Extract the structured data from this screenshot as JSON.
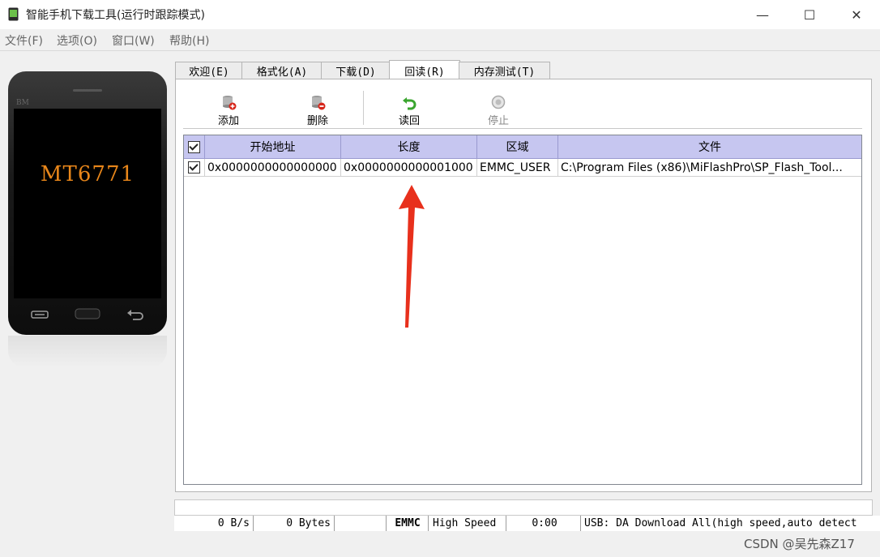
{
  "window": {
    "title": "智能手机下载工具(运行时跟踪模式)",
    "minimize_glyph": "—",
    "maximize_glyph": "☐",
    "close_glyph": "✕"
  },
  "menu": [
    "文件(F)",
    "选项(O)",
    "窗口(W)",
    "帮助(H)"
  ],
  "phone": {
    "brand": "BM",
    "model": "MT6771"
  },
  "tabs": [
    "欢迎(E)",
    "格式化(A)",
    "下载(D)",
    "回读(R)",
    "内存测试(T)"
  ],
  "active_tab": "回读(R)",
  "toolbar": {
    "add": "添加",
    "delete": "删除",
    "readback": "读回",
    "stop": "停止"
  },
  "table": {
    "headers": [
      "开始地址",
      "长度",
      "区域",
      "文件"
    ],
    "rows": [
      {
        "checked": true,
        "start": "0x0000000000000000",
        "length": "0x0000000000001000",
        "region": "EMMC_USER",
        "file": "C:\\Program Files (x86)\\MiFlashPro\\SP_Flash_Tool..."
      }
    ]
  },
  "status": {
    "speed": "0 B/s",
    "bytes": "0 Bytes",
    "storage": "EMMC",
    "mode": "High Speed",
    "time": "0:00",
    "usb": "USB: DA Download All(high speed,auto detect)"
  },
  "watermark": "CSDN @吴先森Z17",
  "colors": {
    "header_bg": "#c6c6f0",
    "phone_model": "#e8861a",
    "arrow": "#e8301c"
  }
}
